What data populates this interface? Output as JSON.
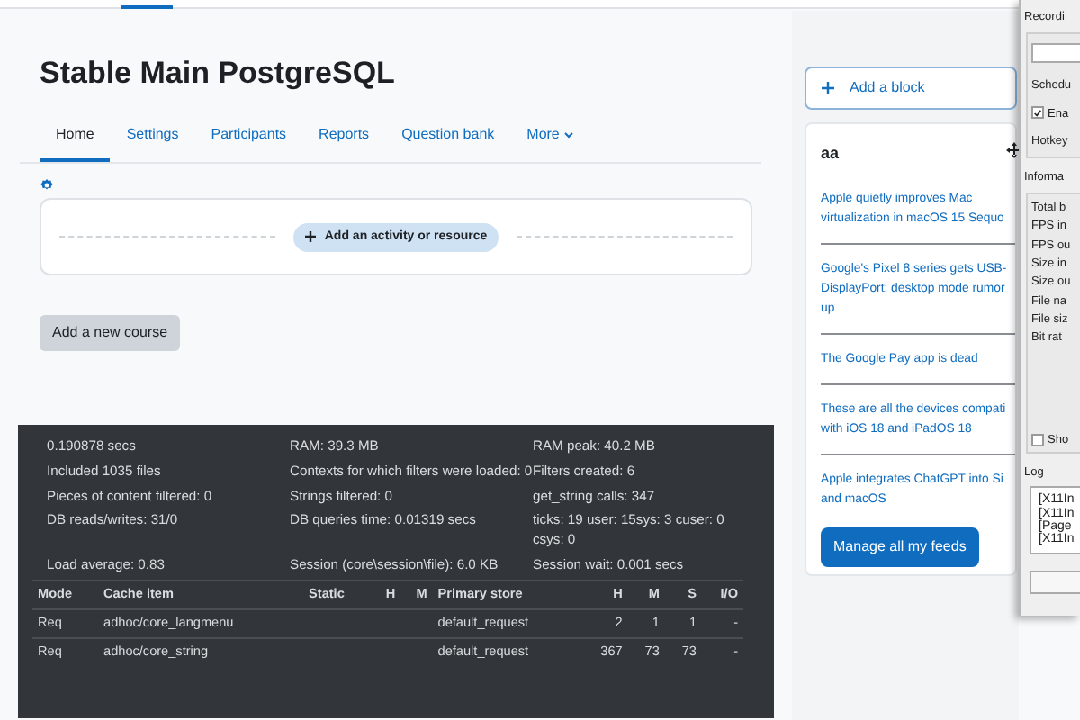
{
  "course": {
    "title": "Stable Main PostgreSQL"
  },
  "tabs": [
    {
      "label": "Home",
      "selected": true
    },
    {
      "label": "Settings",
      "selected": false
    },
    {
      "label": "Participants",
      "selected": false
    },
    {
      "label": "Reports",
      "selected": false
    },
    {
      "label": "Question bank",
      "selected": false
    },
    {
      "label": "More",
      "selected": false,
      "kind": "dropdown"
    }
  ],
  "section": {
    "add_activity": "Add an activity or resource"
  },
  "add_course_button": "Add a new course",
  "sidebar": {
    "add_block": "Add a block",
    "block_title": "aa",
    "feed": [
      {
        "lines": [
          "Apple quietly improves Mac",
          "virtualization in macOS 15 Sequo"
        ]
      },
      {
        "lines": [
          "Google's Pixel 8 series gets USB-",
          "DisplayPort; desktop mode rumor",
          "up"
        ]
      },
      {
        "lines": [
          "The Google Pay app is dead"
        ]
      },
      {
        "lines": [
          "These are all the devices compati",
          "with iOS 18 and iPadOS 18"
        ]
      },
      {
        "lines": [
          "Apple integrates ChatGPT into Si",
          "and macOS"
        ]
      }
    ],
    "manage_button": "Manage all my feeds"
  },
  "perf": {
    "rows": [
      [
        "0.190878 secs",
        "RAM: 39.3 MB",
        "RAM peak: 40.2 MB"
      ],
      [
        "Included 1035 files",
        "Contexts for which filters were loaded: 0",
        "Filters created: 6"
      ],
      [
        "Pieces of content filtered: 0",
        "Strings filtered: 0",
        "get_string calls: 347"
      ],
      [
        "DB reads/writes: 31/0",
        "DB queries time: 0.01319 secs",
        "ticks: 19 user: 15sys: 3 cuser: 0 csys: 0"
      ],
      [
        "Load average: 0.83",
        "Session (core\\session\\file): 6.0 KB",
        "Session wait: 0.001 secs"
      ]
    ],
    "table": {
      "columns": [
        "Mode",
        "Cache item",
        "Static",
        "H",
        "M",
        "Primary store",
        "H",
        "M",
        "S",
        "I/O"
      ],
      "rows": [
        [
          "Req",
          "adhoc/core_langmenu",
          "",
          "",
          "",
          "default_request",
          "2",
          "1",
          "1",
          "-"
        ],
        [
          "Req",
          "adhoc/core_string",
          "",
          "",
          "",
          "default_request",
          "367",
          "73",
          "73",
          "-"
        ]
      ]
    }
  },
  "dialog": {
    "title": "Recordi",
    "schedule_label": "Schedu",
    "enable": {
      "label": "Ena",
      "checked": true
    },
    "hotkey_label": "Hotkey",
    "info_title": "Informa",
    "info_rows": [
      "Total b",
      "FPS in",
      "FPS ou",
      "Size in",
      "Size ou",
      "File na",
      "File siz",
      "Bit rat"
    ],
    "show": {
      "label": "Sho",
      "checked": false
    },
    "log_title": "Log",
    "log_lines": [
      "[X11In",
      "[X11In",
      "[Page",
      "[X11In"
    ]
  }
}
